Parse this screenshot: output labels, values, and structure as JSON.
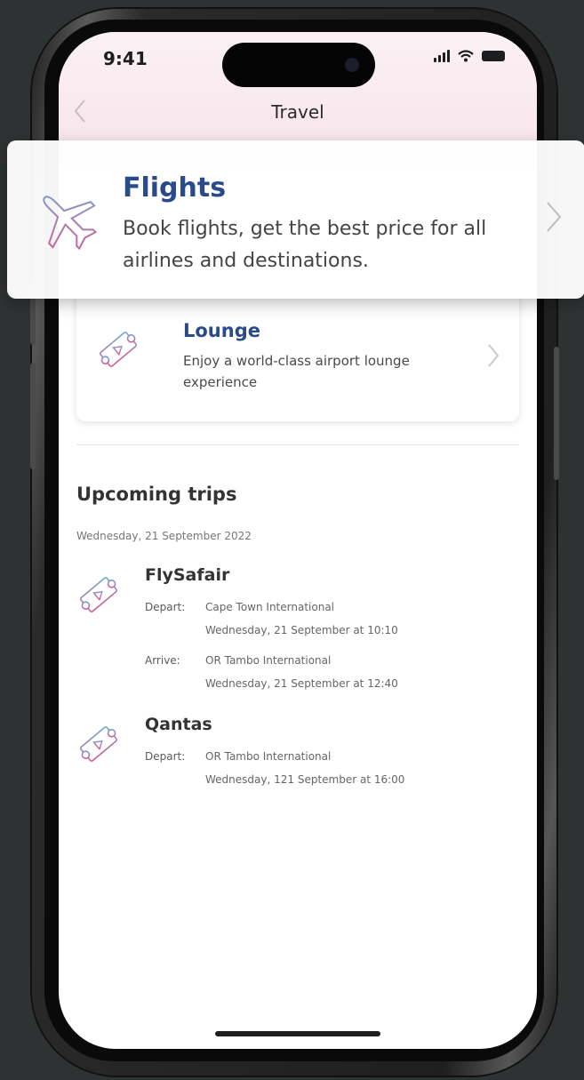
{
  "status_bar": {
    "time": "9:41"
  },
  "nav": {
    "back_icon": "chevron-left-icon",
    "title": "Travel"
  },
  "flights_card": {
    "title": "Flights",
    "description": "Book flights, get the best price for all airlines and destinations.",
    "icon": "plane-icon",
    "chevron": "›"
  },
  "lounge_card": {
    "title": "Lounge",
    "description": "Enjoy a world-class airport lounge experience",
    "icon": "ticket-icon",
    "chevron": "›"
  },
  "upcoming": {
    "heading": "Upcoming trips",
    "date": "Wednesday, 21 September 2022",
    "trips": [
      {
        "airline": "FlySafair",
        "depart_label": "Depart:",
        "depart_place": "Cape Town International",
        "depart_time": "Wednesday, 21 September at 10:10",
        "arrive_label": "Arrive:",
        "arrive_place": "OR Tambo International",
        "arrive_time": "Wednesday, 21 September at 12:40"
      },
      {
        "airline": "Qantas",
        "depart_label": "Depart:",
        "depart_place": "OR Tambo International",
        "depart_time": "Wednesday, 121 September at 16:00"
      }
    ]
  },
  "colors": {
    "accent": "#2a4b89",
    "icon_gradient_start": "#d65a8a",
    "icon_gradient_end": "#6fa8dc"
  }
}
